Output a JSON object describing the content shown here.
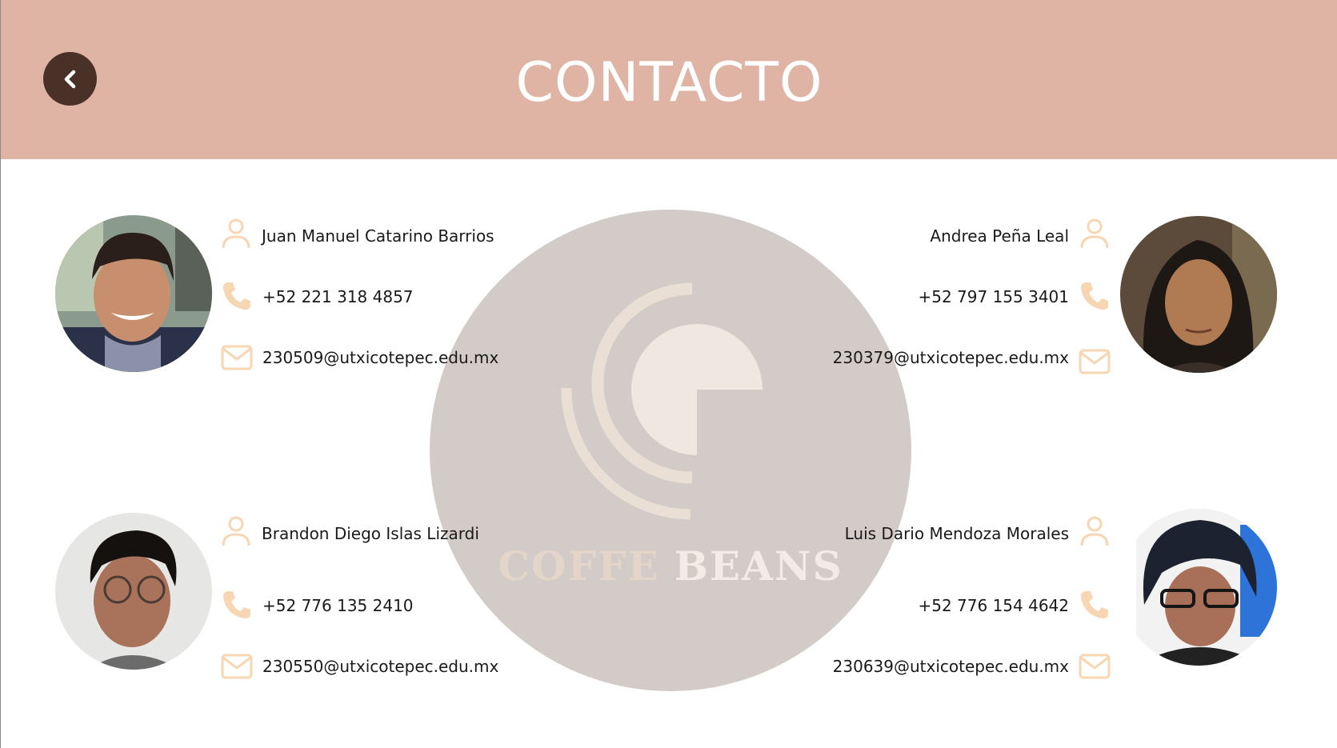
{
  "header": {
    "title": "CONTACTO",
    "background_color": "#dfb4a5",
    "back_button_icon": "chevron-left-icon"
  },
  "logo": {
    "word1": "COFFE",
    "word2": "BEANS",
    "circle_color": "#d2cbc8",
    "mark_color": "#efe8e1"
  },
  "accent_icon_color": "#f7d6b3",
  "contacts": [
    {
      "name": "Juan Manuel Catarino Barrios",
      "phone": "+52 221 318 4857",
      "email": "230509@utxicotepec.edu.mx",
      "icons": [
        "user-icon",
        "phone-icon",
        "mail-icon"
      ]
    },
    {
      "name": "Andrea Peña Leal",
      "phone": "+52 797 155 3401",
      "email": "230379@utxicotepec.edu.mx",
      "icons": [
        "user-icon",
        "phone-icon",
        "mail-icon"
      ]
    },
    {
      "name": "Brandon Diego Islas Lizardi",
      "phone": "+52 776 135 2410",
      "email": "230550@utxicotepec.edu.mx",
      "icons": [
        "user-icon",
        "phone-icon",
        "mail-icon"
      ]
    },
    {
      "name": "Luis Dario Mendoza Morales",
      "phone": "+52 776 154 4642",
      "email": "230639@utxicotepec.edu.mx",
      "icons": [
        "user-icon",
        "phone-icon",
        "mail-icon"
      ]
    }
  ]
}
